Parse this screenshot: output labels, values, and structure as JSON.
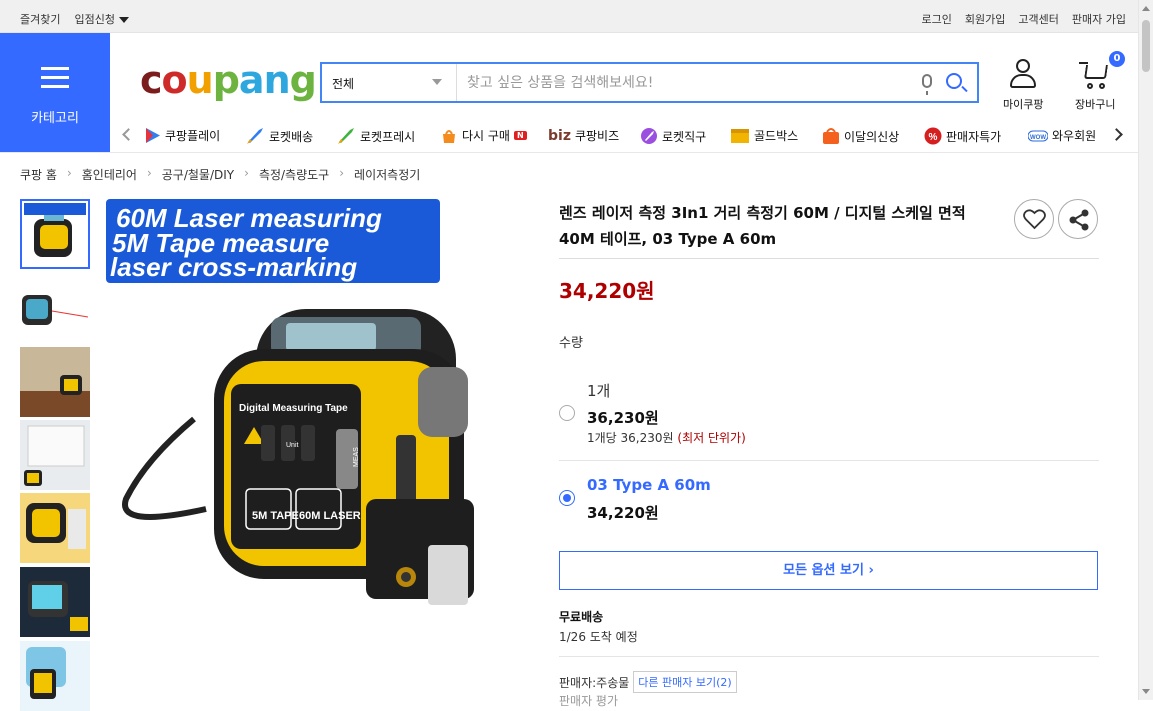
{
  "topbar": {
    "left": [
      "즐겨찾기",
      "입점신청"
    ],
    "right": [
      "로그인",
      "회원가입",
      "고객센터",
      "판매자 가입"
    ]
  },
  "category_label": "카테고리",
  "logo": {
    "text": "coupang",
    "colors": [
      "#7c1d1d",
      "#ce2a2a",
      "#f1a000",
      "#6cb33f",
      "#2ea7df"
    ]
  },
  "search": {
    "category": "전체",
    "placeholder": "찾고 싶은 상품을 검색해보세요!"
  },
  "util": {
    "mypage": "마이쿠팡",
    "cart": "장바구니",
    "cart_count": "0"
  },
  "shortcuts": [
    {
      "label": "쿠팡플레이",
      "icon": "play-icon"
    },
    {
      "label": "로켓배송",
      "icon": "rocket-icon"
    },
    {
      "label": "로켓프레시",
      "icon": "rocket-fresh-icon"
    },
    {
      "label": "다시 구매",
      "icon": "rebuy-icon",
      "badge": "N"
    },
    {
      "label": "쿠팡비즈",
      "icon": "biz-icon",
      "prefix": "biz"
    },
    {
      "label": "로켓직구",
      "icon": "rocket-global-icon"
    },
    {
      "label": "골드박스",
      "icon": "goldbox-icon"
    },
    {
      "label": "이달의신상",
      "icon": "new-arrival-icon"
    },
    {
      "label": "판매자특가",
      "icon": "seller-deal-icon"
    },
    {
      "label": "와우회원",
      "icon": "wow-icon"
    }
  ],
  "breadcrumb": [
    "쿠팡 홈",
    "홈인테리어",
    "공구/철물/DIY",
    "측정/측량도구",
    "레이저측정기"
  ],
  "banner": {
    "line1": "60M Laser measuring",
    "line2": "5M Tape measure",
    "line3": "laser cross-marking"
  },
  "device": {
    "brand_label": "Digital Measuring Tape",
    "tape": "5M TAPE",
    "laser": "60M LASER",
    "unit": "Unit",
    "meas": "MEAS"
  },
  "product": {
    "title": "렌즈 레이저 측정 3In1 거리 측정기 60M / 디지털 스케일 면적 40M 테이프, 03 Type A 60m",
    "price": "34,220원",
    "qty_label": "수량"
  },
  "options": [
    {
      "name": "1개",
      "price": "36,230원",
      "unit": "1개당 36,230원",
      "unit_note": "(최저 단위가)",
      "selected": false
    },
    {
      "name": "03 Type A 60m",
      "price": "34,220원",
      "selected": true
    }
  ],
  "all_options_label": "모든 옵션 보기 ›",
  "shipping": {
    "title": "무료배송",
    "eta": "1/26 도착 예정"
  },
  "seller": {
    "label": "판매자:주송물",
    "other": "다른 판매자 보기(2)",
    "cutoff": "판매자 평가"
  }
}
